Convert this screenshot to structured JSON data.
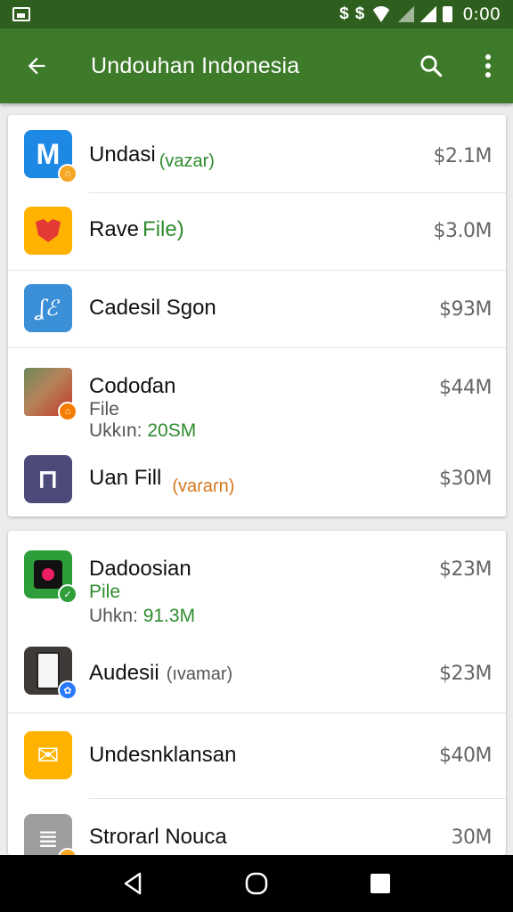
{
  "status_bar": {
    "time": "0:00",
    "icons": [
      "image-icon",
      "dollar-icon",
      "dollar-icon",
      "wifi-icon",
      "signal-icon",
      "signal-icon",
      "battery-icon"
    ],
    "dollar_glyphs": [
      "$",
      "$"
    ]
  },
  "app_bar": {
    "title": "Undouhan Indonesia",
    "back_icon": "back-arrow-icon",
    "search_icon": "search-icon",
    "more_icon": "more-vert-icon",
    "color": "#3d7a29",
    "status_color": "#2f5f1f"
  },
  "groups": [
    {
      "items": [
        {
          "name": "Undasi",
          "tag": "(vazar)",
          "tag_color": "green",
          "size": "$2.1M",
          "icon": "m-app-icon",
          "icon_color": "#1e88e5",
          "icon_glyph": "M",
          "badge_color": "#f5a623",
          "badge_glyph": "⌂"
        },
        {
          "name": "Rave",
          "tag": "File)",
          "tag_color": "green",
          "size": "$3.0M",
          "icon": "red-shield-app-icon",
          "icon_color": "#ffb300",
          "icon_glyph": ""
        },
        {
          "name": "Cadesil Sgon",
          "tag": "",
          "size": "$93M",
          "icon": "signature-app-icon",
          "icon_color": "#3a8fd6",
          "icon_glyph": "ʆℰ"
        },
        {
          "name": "Codoɗan",
          "sub1": "File",
          "sub2_label": "Ukkın:",
          "sub2_value": "20SM",
          "size": "$44M",
          "icon": "photo-app-icon",
          "icon_color": "#8d6e63",
          "badge_color": "#f57c00",
          "badge_glyph": "⌂"
        },
        {
          "name": "Uan Fill",
          "tag": "(vaɾaɾn)",
          "tag_color": "orange",
          "size": "$30M",
          "icon": "frame-app-icon",
          "icon_color": "#4b4a7a",
          "icon_glyph": "⊓"
        }
      ]
    },
    {
      "items": [
        {
          "name": "Dadoosian",
          "sub1": "Pile",
          "sub2_label": "Uhkn:",
          "sub2_value": "91.3M",
          "size": "$23M",
          "icon": "dark-app-icon",
          "icon_color": "#2e9e3a",
          "badge_color": "#2e9e3a",
          "badge_glyph": "✓"
        },
        {
          "name": "Audesii",
          "tag": "(ıvamar)",
          "tag_color": "grey",
          "size": "$23M",
          "icon": "phone-app-icon",
          "icon_color": "#3e3a38",
          "badge_color": "#2979ff",
          "badge_glyph": "✿"
        },
        {
          "name": "Undesnklansan",
          "tag": "",
          "size": "$40M",
          "icon": "envelope-app-icon",
          "icon_color": "#ffb300",
          "icon_glyph": "✉"
        },
        {
          "name": "Stroraɾl Nouca",
          "tag": "",
          "size": "30M",
          "icon": "document-app-icon",
          "icon_color": "#9e9e9e",
          "icon_glyph": "≣",
          "badge_color": "#f5a623"
        }
      ]
    }
  ],
  "nav_bar": {
    "back_icon": "nav-back-icon",
    "home_icon": "nav-home-icon",
    "recents_icon": "nav-recents-icon"
  }
}
